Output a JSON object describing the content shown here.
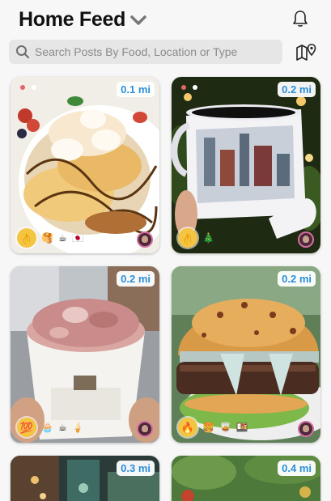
{
  "header": {
    "title": "Home Feed",
    "chevron_icon": "chevron-down-icon",
    "notification_icon": "bell-icon"
  },
  "search": {
    "placeholder": "Search Posts By Food, Location or Type",
    "icon": "search-icon",
    "map_icon": "map-pin-icon"
  },
  "posts": [
    {
      "distance": "0.1 mi",
      "emojis": [
        "👌",
        "🥞",
        "☕",
        "🇯🇵"
      ]
    },
    {
      "distance": "0.2 mi",
      "emojis": [
        "👌",
        "🎄"
      ]
    },
    {
      "distance": "0.2 mi",
      "emojis": [
        "💯",
        "🧁",
        "☕",
        "🍦"
      ]
    },
    {
      "distance": "0.2 mi",
      "emojis": [
        "🔥",
        "🍔",
        "🥃",
        "🍱"
      ]
    },
    {
      "distance": "0.3 mi",
      "emojis": []
    },
    {
      "distance": "0.4 mi",
      "emojis": []
    }
  ],
  "colors": {
    "distance_text": "#2a8fd8",
    "badge_bg": "#f3c542",
    "search_bg": "#e6e6e6"
  }
}
